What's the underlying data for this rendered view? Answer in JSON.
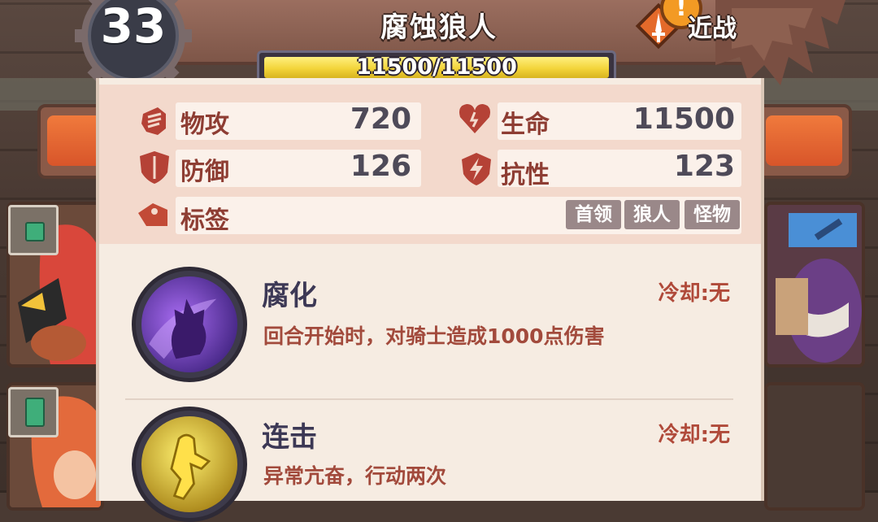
{
  "level": "33",
  "monster": {
    "name": "腐蚀狼人",
    "type_label": "近战",
    "type_icon": "sword-type-icon",
    "alert_icon": "!",
    "hp": {
      "current": 11500,
      "max": 11500,
      "text": "11500/11500"
    }
  },
  "stats": {
    "atk": {
      "label": "物攻",
      "value": "720",
      "icon": "fist-icon"
    },
    "hp": {
      "label": "生命",
      "value": "11500",
      "icon": "heart-icon"
    },
    "def": {
      "label": "防御",
      "value": "126",
      "icon": "shield-icon"
    },
    "res": {
      "label": "抗性",
      "value": "123",
      "icon": "lightning-shield-icon"
    },
    "tags": {
      "label": "标签",
      "icon": "tag-icon",
      "items": [
        "首领",
        "狼人",
        "怪物"
      ]
    }
  },
  "skills": [
    {
      "name": "腐化",
      "cooldown": "冷却:无",
      "desc": "回合开始时，对骑士造成1000点伤害",
      "icon": "corruption-skill-icon"
    },
    {
      "name": "连击",
      "cooldown": "冷却:无",
      "desc": "异常亢奋，行动两次",
      "icon": "combo-skill-icon"
    }
  ],
  "colors": {
    "panel_bg": "#f6ece2",
    "stat_label": "#8e3d33",
    "stat_value": "#4e4a58",
    "hp_fill": "#f3d43a",
    "skill_cd": "#b04a3a"
  }
}
